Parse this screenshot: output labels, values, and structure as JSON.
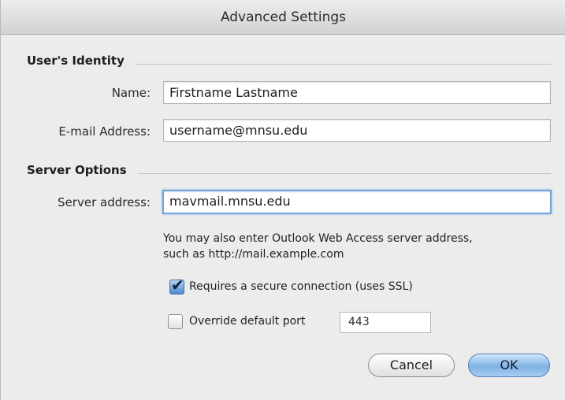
{
  "window": {
    "title": "Advanced Settings"
  },
  "identity": {
    "section_label": "User's Identity",
    "name_label": "Name:",
    "name_value": "Firstname Lastname",
    "email_label": "E-mail Address:",
    "email_value": "username@mnsu.edu"
  },
  "server": {
    "section_label": "Server Options",
    "address_label": "Server address:",
    "address_value": "mavmail.mnsu.edu",
    "help_line1": "You may also enter Outlook Web Access server address,",
    "help_line2": "such as http://mail.example.com",
    "ssl_label": "Requires a secure connection (uses SSL)",
    "ssl_checked": true,
    "port_label": "Override default port",
    "port_checked": false,
    "port_value": "443"
  },
  "buttons": {
    "cancel": "Cancel",
    "ok": "OK"
  },
  "colors": {
    "accent": "#6fa3d9",
    "ok_button": "#7fb1e4"
  },
  "icons": {
    "ssl_checkbox": "checkmark-icon"
  }
}
